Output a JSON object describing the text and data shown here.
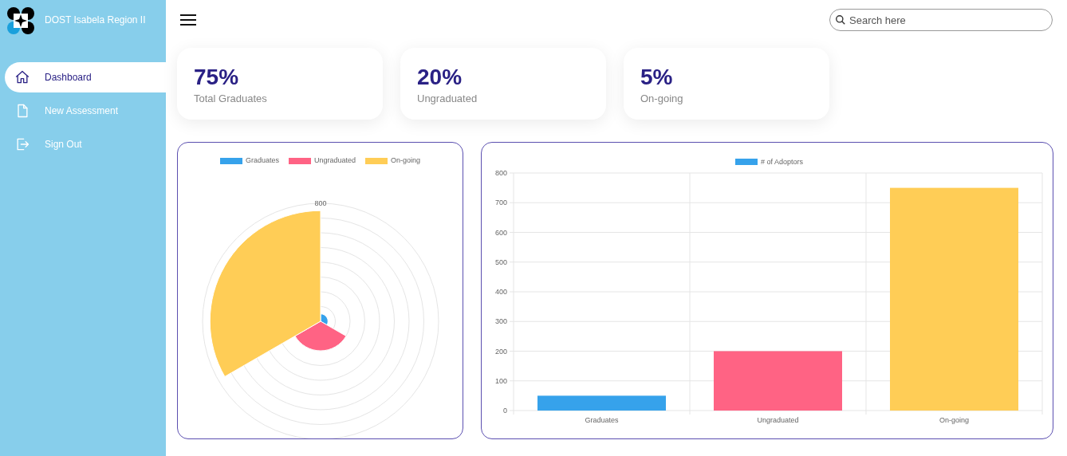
{
  "brand": {
    "title": "DOST Isabela Region II"
  },
  "sidebar": {
    "items": [
      {
        "label": "Dashboard",
        "selected": true
      },
      {
        "label": "New Assessment",
        "selected": false
      },
      {
        "label": "Sign Out",
        "selected": false
      }
    ]
  },
  "search": {
    "placeholder": "Search here"
  },
  "cards": [
    {
      "value": "75%",
      "label": "Total Graduates"
    },
    {
      "value": "20%",
      "label": "Ungraduated"
    },
    {
      "value": "5%",
      "label": "On-going"
    }
  ],
  "polar_chart": {
    "legend": [
      {
        "label": "Graduates",
        "color": "#36a2eb"
      },
      {
        "label": "Ungraduated",
        "color": "#ff6384"
      },
      {
        "label": "On-going",
        "color": "#ffcd56"
      }
    ],
    "scale_label": "800"
  },
  "bar_chart": {
    "legend": {
      "color": "#36a2eb"
    },
    "bars": [
      {
        "color": "#36a2eb"
      },
      {
        "color": "#ff6384"
      },
      {
        "color": "#ffcd56"
      }
    ],
    "chart_data": {
      "type": "bar",
      "categories": [
        "Graduates",
        "Ungraduated",
        "On-going"
      ],
      "ylim": [
        0,
        800
      ],
      "yticks": [
        0,
        100,
        200,
        300,
        400,
        500,
        600,
        700,
        800
      ],
      "grid": true,
      "series": [
        {
          "name": "# of Adoptors",
          "values": [
            50,
            200,
            750
          ]
        }
      ]
    }
  }
}
